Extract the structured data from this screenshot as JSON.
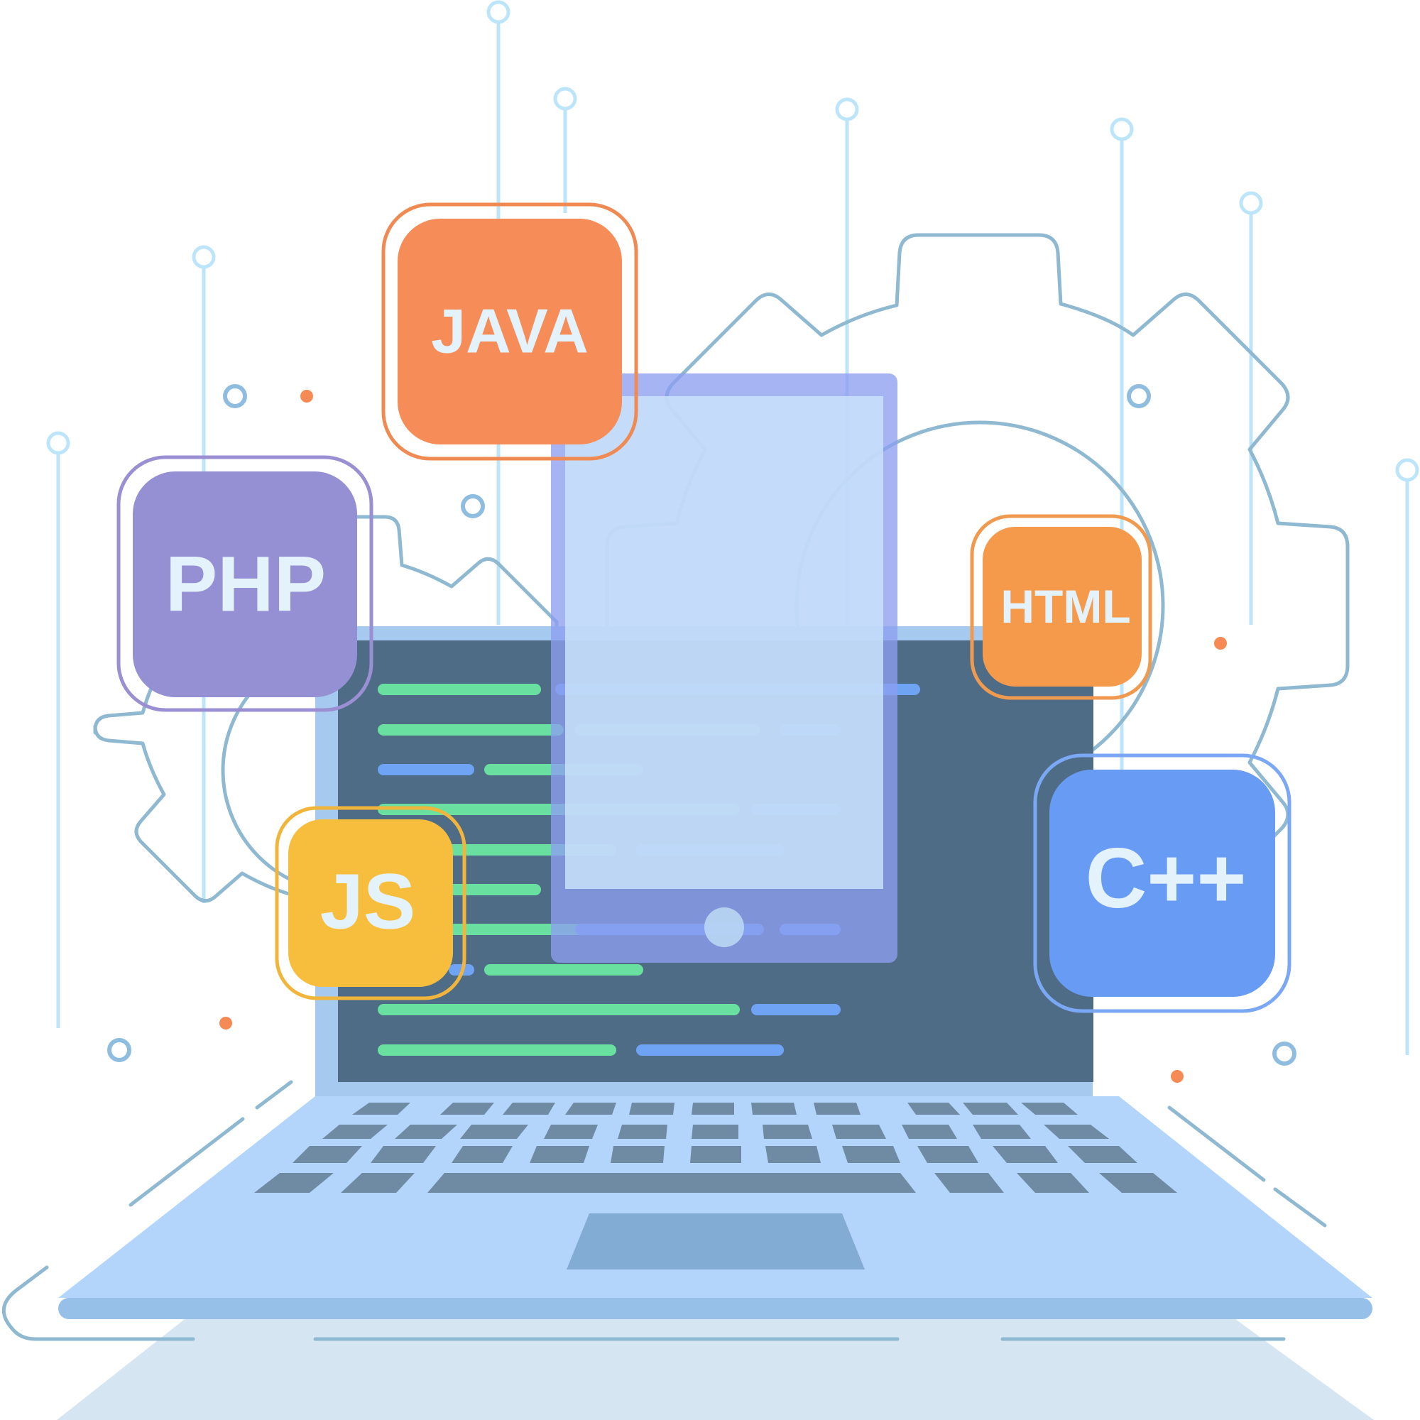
{
  "badges": {
    "java": {
      "label": "JAVA",
      "color": "#f68c57",
      "outline": "#f08a53"
    },
    "php": {
      "label": "PHP",
      "color": "#958fd4",
      "outline": "#9a8fd2"
    },
    "html": {
      "label": "HTML",
      "color": "#f59a4b",
      "outline": "#f09a50"
    },
    "js": {
      "label": "JS",
      "color": "#f7be3e",
      "outline": "#f1b53b"
    },
    "cpp": {
      "label": "C++",
      "color": "#689bf3",
      "outline": "#7ba8f4"
    }
  },
  "colors": {
    "screen": "#4f6c86",
    "laptop_body": "#b3d5fc",
    "laptop_frame": "#a5c9ef",
    "keys": "#6f8ba3",
    "code_green": "#69e09f",
    "code_blue": "#6fa4f4",
    "gear_line": "#8fb8d1",
    "circuit_line": "#bde5fa",
    "accent_dot": "#f68a55"
  },
  "icons": [
    "gear-icon",
    "circuit-lines",
    "laptop",
    "smartphone",
    "code-lines"
  ]
}
